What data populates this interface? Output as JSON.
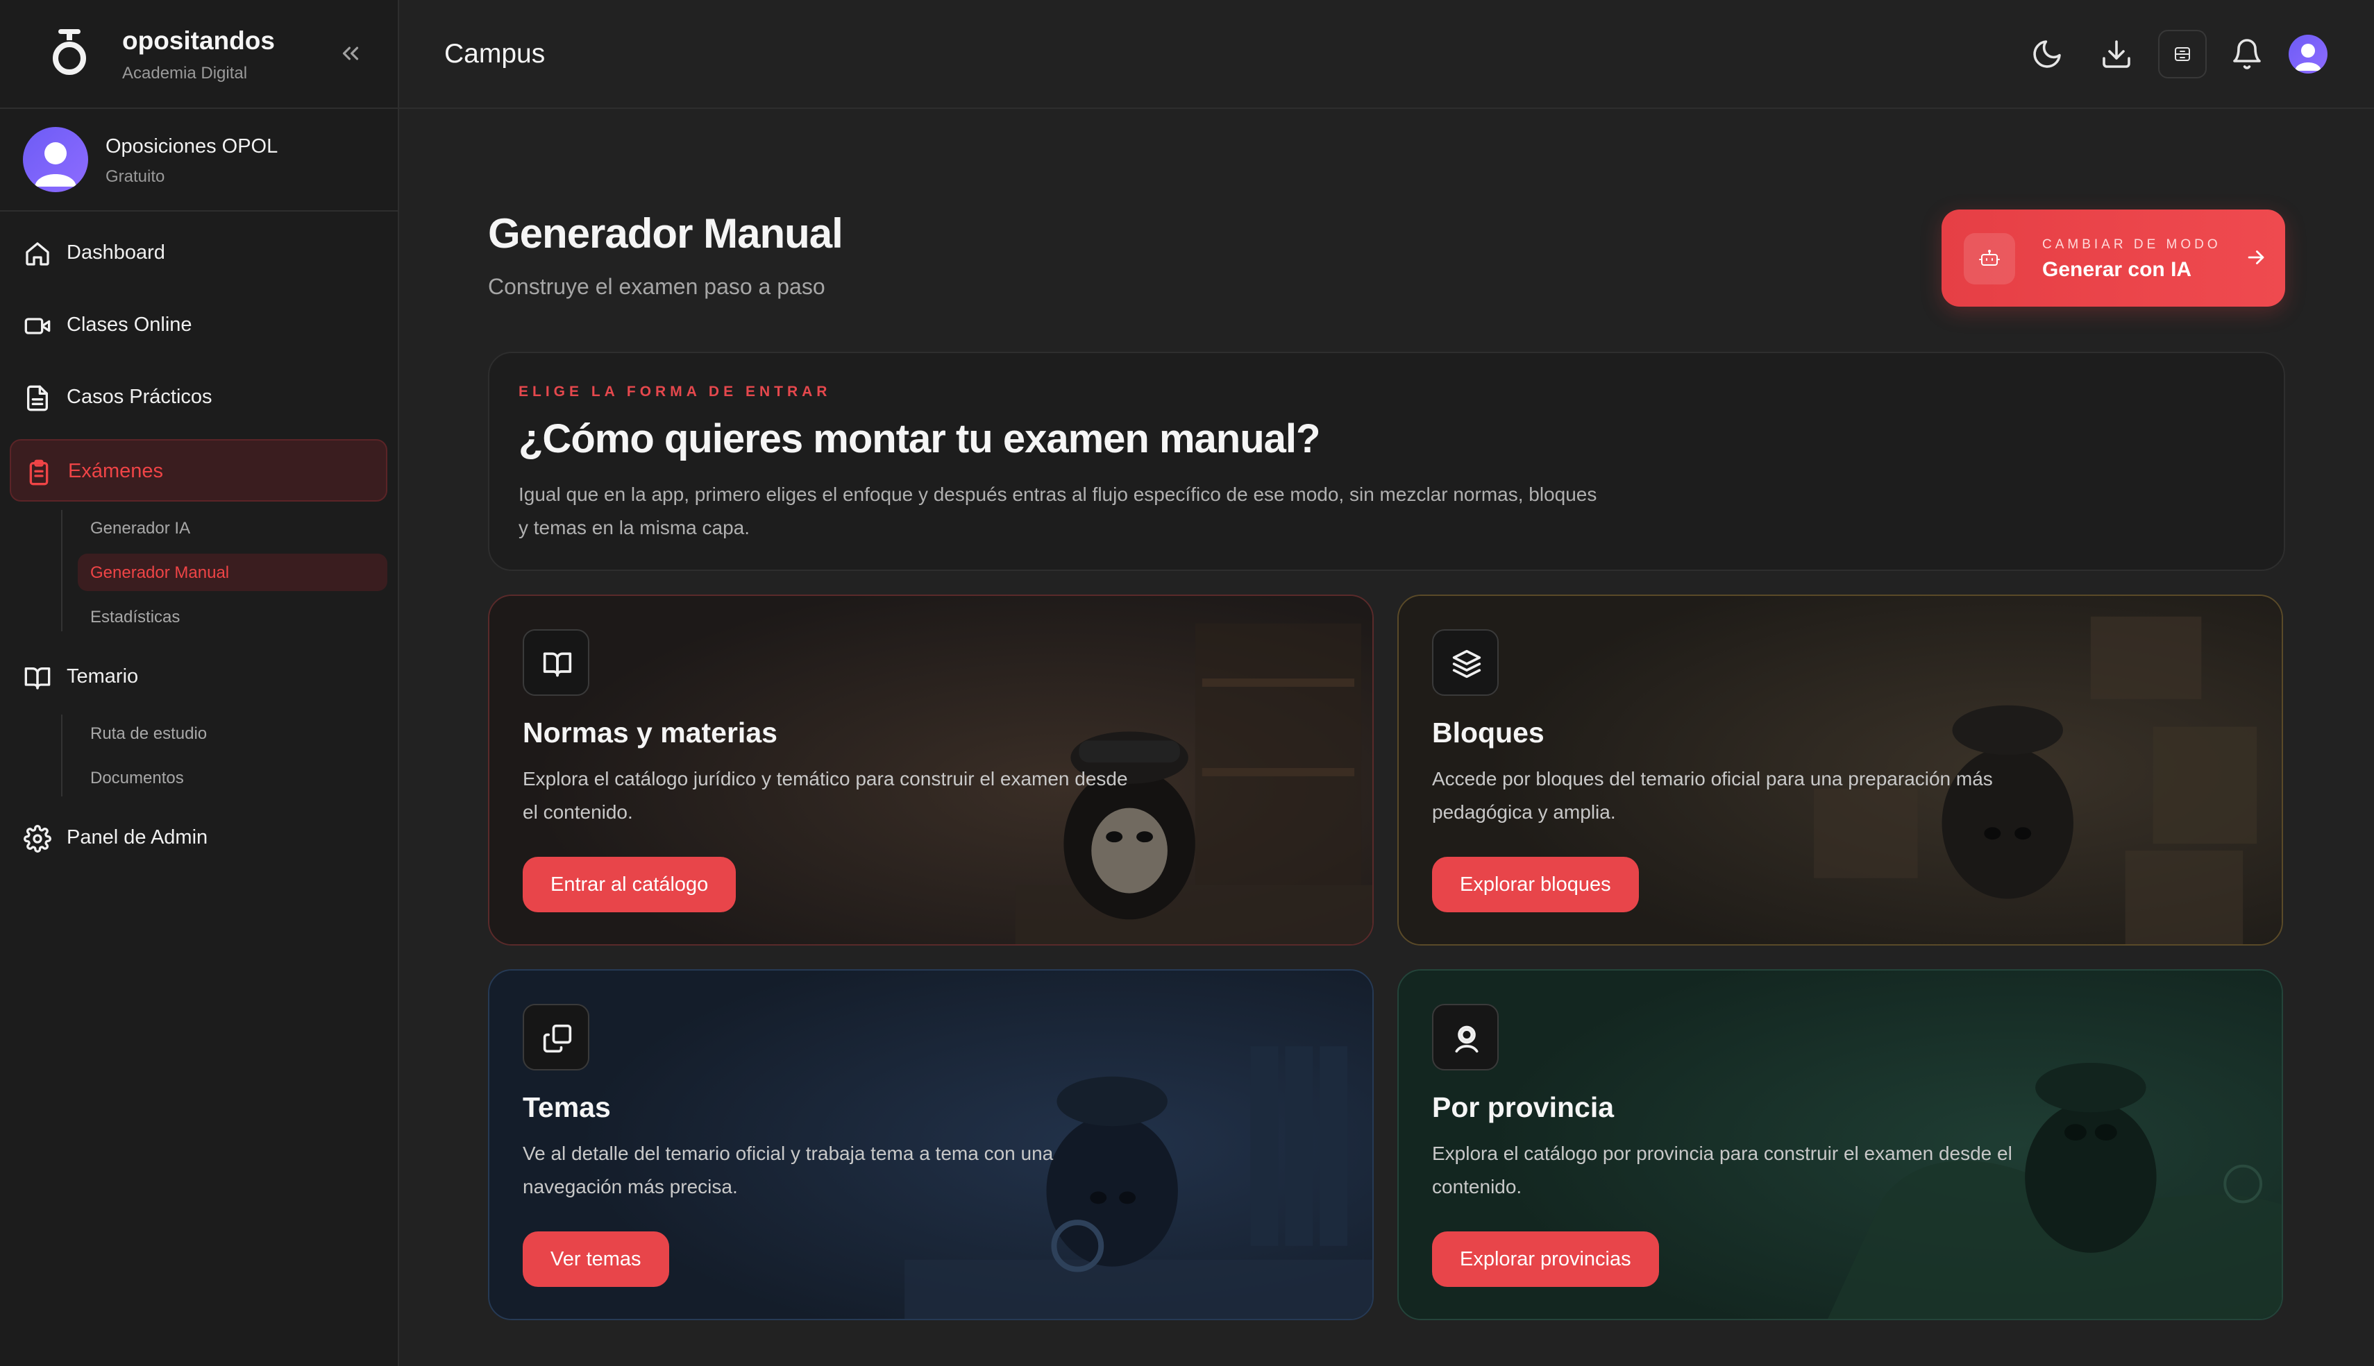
{
  "brand": {
    "name": "opositandos",
    "subtitle": "Academia Digital"
  },
  "account": {
    "name": "Oposiciones OPOL",
    "plan": "Gratuito"
  },
  "sidebar": {
    "items": [
      {
        "label": "Dashboard",
        "icon": "home-icon"
      },
      {
        "label": "Clases Online",
        "icon": "video-camera-icon"
      },
      {
        "label": "Casos Prácticos",
        "icon": "document-icon"
      },
      {
        "label": "Exámenes",
        "icon": "clipboard-list-icon",
        "active": true,
        "children": [
          {
            "label": "Generador IA"
          },
          {
            "label": "Generador Manual",
            "active": true
          },
          {
            "label": "Estadísticas"
          }
        ]
      },
      {
        "label": "Temario",
        "icon": "open-book-icon",
        "children": [
          {
            "label": "Ruta de estudio"
          },
          {
            "label": "Documentos"
          }
        ]
      },
      {
        "label": "Panel de Admin",
        "icon": "gear-icon"
      }
    ]
  },
  "topbar": {
    "title": "Campus",
    "actions": [
      "moon-icon",
      "download-icon",
      "archive-icon",
      "bell-icon",
      "user-avatar"
    ]
  },
  "main": {
    "title": "Generador Manual",
    "subtitle": "Construye el examen paso a paso",
    "mode_switch": {
      "kicker": "CAMBIAR DE MODO",
      "label": "Generar con IA"
    },
    "intro": {
      "kicker": "ELIGE LA FORMA DE ENTRAR",
      "title": "¿Cómo quieres montar tu examen manual?",
      "description": "Igual que en la app, primero eliges el enfoque y después entras al flujo específico de ese modo, sin mezclar normas, bloques y temas en la misma capa."
    },
    "cards": [
      {
        "title": "Normas y materias",
        "description": "Explora el catálogo jurídico y temático para construir el examen desde el contenido.",
        "button": "Entrar al catálogo",
        "icon": "open-book-icon"
      },
      {
        "title": "Bloques",
        "description": "Accede por bloques del temario oficial para una preparación más pedagógica y amplia.",
        "button": "Explorar bloques",
        "icon": "layers-icon"
      },
      {
        "title": "Temas",
        "description": "Ve al detalle del temario oficial y trabaja tema a tema con una navegación más precisa.",
        "button": "Ver temas",
        "icon": "copy-icon"
      },
      {
        "title": "Por provincia",
        "description": "Explora el catálogo por provincia para construir el examen desde el contenido.",
        "button": "Explorar provincias",
        "icon": "map-pin-icon"
      }
    ]
  },
  "colors": {
    "accent": "#e8454a",
    "background": "#222222",
    "sidebar": "#1c1c1c"
  }
}
